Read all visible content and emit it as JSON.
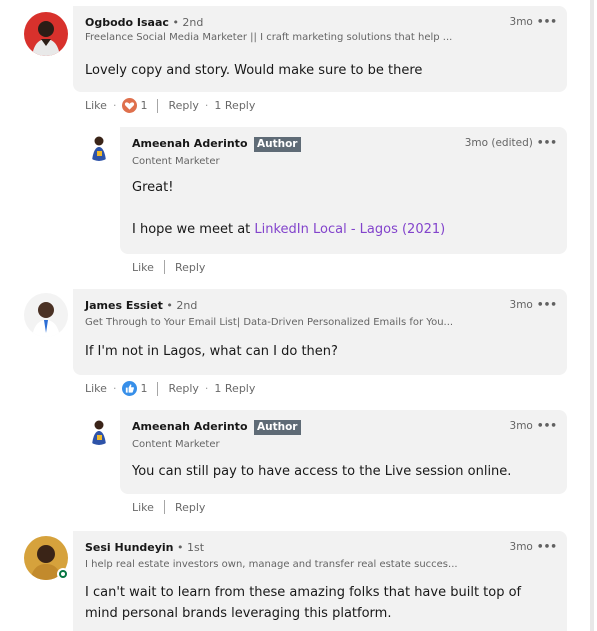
{
  "comments": [
    {
      "name": "Ogbodo Isaac",
      "degree": "• 2nd",
      "headline": "Freelance Social Media Marketer || I craft marketing solutions that help ...",
      "time": "3mo",
      "text": "Lovely copy and story. Would make sure to be there",
      "like_label": "Like",
      "reaction_count": "1",
      "reply_label": "Reply",
      "replies_count": "1 Reply",
      "reply": {
        "name": "Ameenah Aderinto",
        "badge": "Author",
        "headline": "Content Marketer",
        "time": "3mo (edited)",
        "text_line1": "Great!",
        "text_line2_prefix": "I hope we meet at ",
        "text_line2_link": "LinkedIn Local - Lagos (2021)",
        "like_label": "Like",
        "reply_label": "Reply"
      }
    },
    {
      "name": "James Essiet",
      "degree": "• 2nd",
      "headline": "Get Through to Your Email List| Data-Driven Personalized Emails for You...",
      "time": "3mo",
      "text": "If I'm not in Lagos, what can I do then?",
      "like_label": "Like",
      "reaction_count": "1",
      "reply_label": "Reply",
      "replies_count": "1 Reply",
      "reply": {
        "name": "Ameenah Aderinto",
        "badge": "Author",
        "headline": "Content Marketer",
        "time": "3mo",
        "text": "You can still pay to have access to the Live session online.",
        "like_label": "Like",
        "reply_label": "Reply"
      }
    },
    {
      "name": "Sesi Hundeyin",
      "degree": "• 1st",
      "headline": "I help real estate investors own, manage and transfer real estate succes...",
      "time": "3mo",
      "text_line1": "I can't wait to learn from these amazing folks that have built top of",
      "text_line2": "mind personal brands leveraging this platform."
    }
  ],
  "more_icon": "•••",
  "colors": {
    "bubble": "#f2f2f2",
    "author_badge": "#5f6b76",
    "link": "#8344cc",
    "love_reaction": "#df704d",
    "like_reaction": "#378fe9",
    "online": "#057642"
  }
}
